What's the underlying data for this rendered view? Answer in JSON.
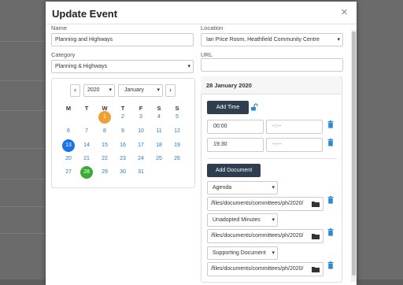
{
  "modal": {
    "title": "Update Event",
    "close_glyph": "×"
  },
  "form": {
    "name_label": "Name",
    "name_value": "Planning and Highways",
    "category_label": "Category",
    "category_value": "Planning & Highways",
    "location_label": "Location",
    "location_value": "Ian Price Room, Heathfield Community Centre",
    "url_label": "URL",
    "url_value": ""
  },
  "calendar": {
    "prev_glyph": "‹",
    "next_glyph": "›",
    "year": "2020",
    "month": "January",
    "weekdays": [
      "M",
      "T",
      "W",
      "T",
      "F",
      "S",
      "S"
    ],
    "weeks": [
      [
        "",
        "",
        "1",
        "2",
        "3",
        "4",
        "5"
      ],
      [
        "6",
        "7",
        "8",
        "9",
        "10",
        "11",
        "12"
      ],
      [
        "13",
        "14",
        "15",
        "16",
        "17",
        "18",
        "19"
      ],
      [
        "20",
        "21",
        "22",
        "23",
        "24",
        "25",
        "26"
      ],
      [
        "27",
        "28",
        "29",
        "30",
        "31",
        "",
        ""
      ]
    ],
    "today": "1",
    "selected": [
      "13",
      "28"
    ]
  },
  "event_panel": {
    "date_heading": "28 January 2020",
    "add_time_label": "Add Time",
    "times": [
      {
        "start": "00:00",
        "end": "--:--"
      },
      {
        "start": "19:30",
        "end": "--:--"
      }
    ],
    "add_document_label": "Add Document",
    "documents": [
      {
        "type": "Agenda",
        "path": "/files/documents/committees/ph/2020/"
      },
      {
        "type": "Unadopted Minutes",
        "path": "/files/documents/committees/ph/2020/"
      },
      {
        "type": "Supporting Document",
        "path": "/files/documents/committees/ph/2020/"
      }
    ]
  },
  "colors": {
    "accent": "#2a7bbd",
    "today": "#f0a030",
    "selected_blue": "#1a73e8",
    "selected_green": "#3aaa35",
    "dark_button": "#2f3e4e",
    "trash": "#2a8ad4"
  }
}
